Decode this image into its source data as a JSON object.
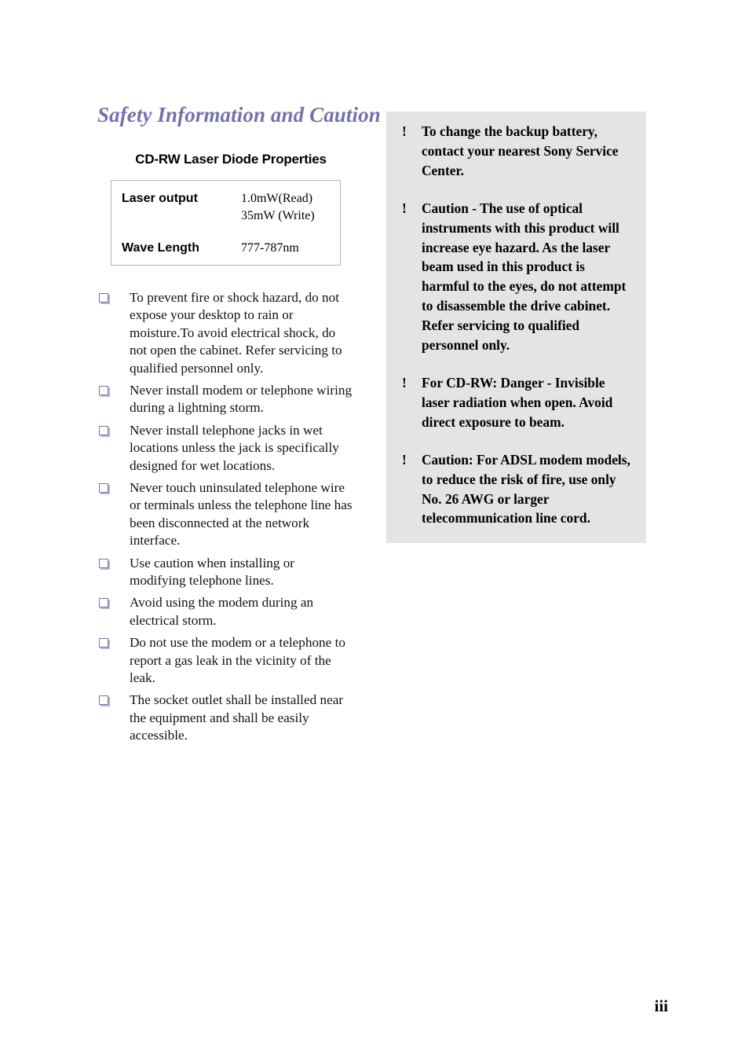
{
  "document": {
    "page_number": "iii",
    "accent_color": "#7373ab",
    "panel_background": "#e4e4e4"
  },
  "left_column": {
    "section_title": "Safety Information and Caution",
    "table_heading": "CD-RW Laser Diode Properties",
    "spec_table": {
      "rows": [
        {
          "label": "Laser output",
          "values": [
            "1.0mW(Read)",
            "35mW (Write)"
          ]
        },
        {
          "label": "Wave Length",
          "values": [
            "777-787nm"
          ]
        }
      ]
    },
    "bullets": [
      "To prevent fire or shock hazard, do not expose your desktop to rain or moisture.To avoid electrical shock, do not open the cabinet. Refer servicing to qualified personnel only.",
      "Never install modem or telephone wiring during a lightning storm.",
      "Never install telephone jacks in wet locations unless the jack is specifically designed for wet locations.",
      "Never touch uninsulated telephone wire or terminals unless the telephone line has been disconnected at the network interface.",
      "Use caution when installing or modifying telephone lines.",
      "Avoid using the modem during an electrical storm.",
      "Do not use the modem or a telephone to report a gas leak in the vicinity of the leak.",
      "The socket outlet shall be installed near the equipment and shall be easily accessible."
    ]
  },
  "caution_panel": {
    "marker": "!",
    "items": [
      "To change the backup battery, contact your nearest Sony Service Center.",
      "Caution - The use of optical instruments with this product will increase eye hazard. As the laser beam used in this product is harmful to the eyes, do not attempt to disassemble the drive cabinet. Refer servicing to qualified personnel only.",
      "For CD-RW: Danger - Invisible laser radiation when open. Avoid direct exposure to beam.",
      "Caution: For ADSL modem models, to reduce the risk of fire, use only No. 26 AWG or larger telecommunication line cord."
    ]
  }
}
